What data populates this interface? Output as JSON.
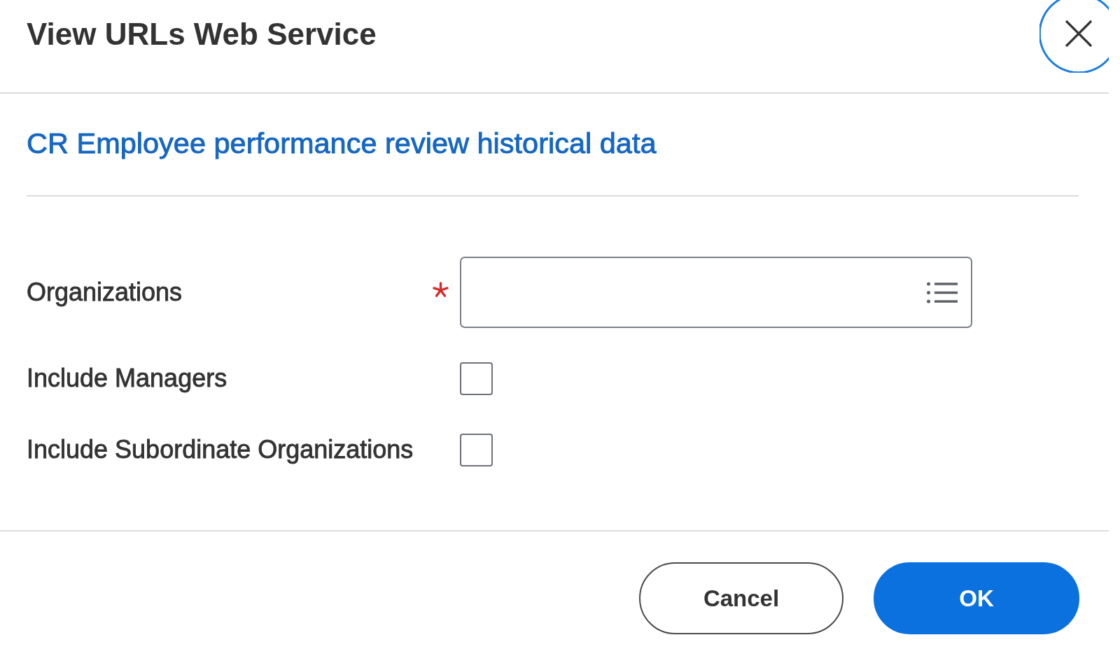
{
  "dialog": {
    "title": "View URLs Web Service",
    "link": "CR Employee performance review historical data",
    "fields": [
      {
        "kind": "select",
        "label": "Organizations",
        "required": true
      },
      {
        "kind": "checkbox",
        "label": "Include Managers",
        "checked": false
      },
      {
        "kind": "checkbox",
        "label": "Include Subordinate Organizations",
        "checked": false
      }
    ],
    "buttons": [
      {
        "kind": "secondary",
        "label": "Cancel"
      },
      {
        "kind": "primary",
        "label": "OK"
      }
    ]
  }
}
